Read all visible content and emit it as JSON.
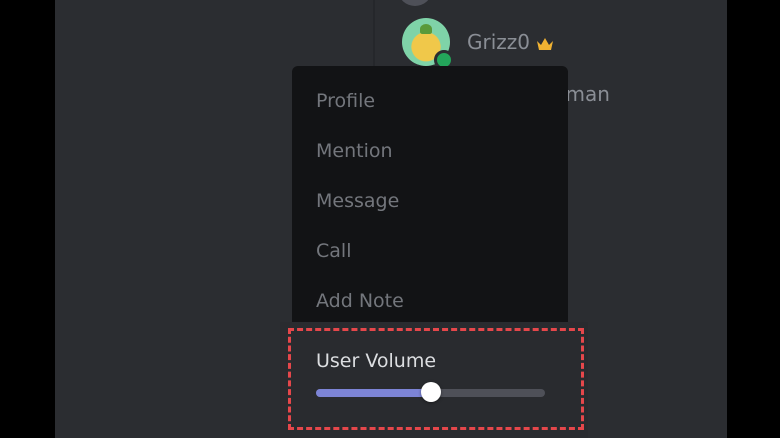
{
  "members": [
    {
      "name": "Grizz0",
      "crown": true,
      "status": "online"
    },
    {
      "name": "appleman"
    }
  ],
  "context_menu": {
    "items": [
      {
        "label": "Profile"
      },
      {
        "label": "Mention"
      },
      {
        "label": "Message"
      },
      {
        "label": "Call"
      },
      {
        "label": "Add Note"
      }
    ],
    "volume": {
      "label": "User Volume",
      "level_fraction": 0.5
    }
  },
  "colors": {
    "background": "#2b2d31",
    "menu": "#121315",
    "slider_fill": "#7c84d6",
    "highlight": "#e5474b",
    "crown": "#f0b232",
    "online": "#23a55a"
  }
}
